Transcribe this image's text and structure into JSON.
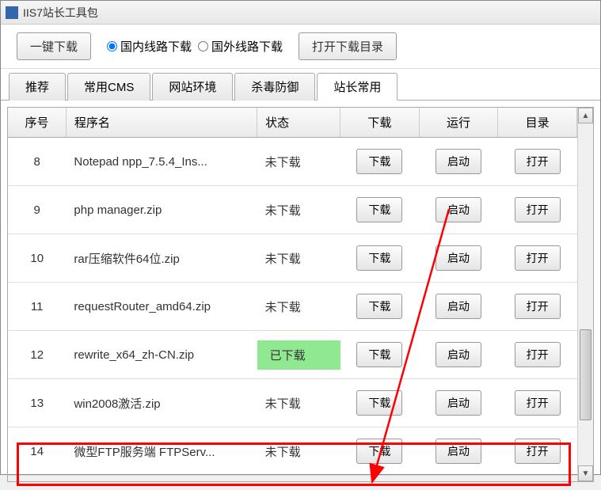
{
  "window": {
    "title": "IIS7站长工具包"
  },
  "toolbar": {
    "download_all": "一键下载",
    "radio_domestic": "国内线路下载",
    "radio_foreign": "国外线路下载",
    "open_dir": "打开下载目录"
  },
  "tabs": [
    {
      "label": "推荐",
      "active": false
    },
    {
      "label": "常用CMS",
      "active": false
    },
    {
      "label": "网站环境",
      "active": false
    },
    {
      "label": "杀毒防御",
      "active": false
    },
    {
      "label": "站长常用",
      "active": true
    }
  ],
  "table": {
    "headers": {
      "index": "序号",
      "name": "程序名",
      "status": "状态",
      "download": "下载",
      "run": "运行",
      "dir": "目录"
    },
    "status_not_downloaded": "未下载",
    "status_downloaded": "已下载",
    "btn_download": "下载",
    "btn_run": "启动",
    "btn_open": "打开",
    "rows": [
      {
        "index": "8",
        "name": "Notepad npp_7.5.4_Ins...",
        "status": "未下载",
        "downloaded": false
      },
      {
        "index": "9",
        "name": "php manager.zip",
        "status": "未下载",
        "downloaded": false
      },
      {
        "index": "10",
        "name": "rar压缩软件64位.zip",
        "status": "未下载",
        "downloaded": false
      },
      {
        "index": "11",
        "name": "requestRouter_amd64.zip",
        "status": "未下载",
        "downloaded": false
      },
      {
        "index": "12",
        "name": "rewrite_x64_zh-CN.zip",
        "status": "已下载",
        "downloaded": true
      },
      {
        "index": "13",
        "name": "win2008激活.zip",
        "status": "未下载",
        "downloaded": false
      },
      {
        "index": "14",
        "name": "微型FTP服务端 FTPServ...",
        "status": "未下载",
        "downloaded": false
      }
    ]
  },
  "annotation": {
    "highlight_row_index": 6,
    "arrow_color": "#ff0000"
  }
}
